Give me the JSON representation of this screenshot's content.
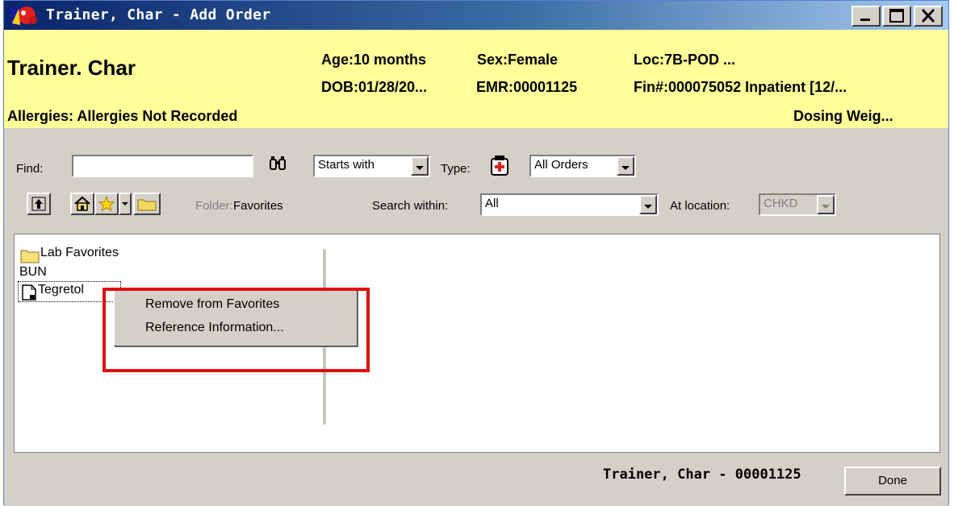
{
  "window": {
    "title": "Trainer, Char - Add Order",
    "controls": {
      "minimize": "minimize",
      "maximize": "maximize",
      "close": "close"
    }
  },
  "banner": {
    "patient_name": "Trainer. Char",
    "age": "Age:10 months",
    "sex": "Sex:Female",
    "loc": "Loc:7B-POD ...",
    "dob": "DOB:01/28/20...",
    "emr": "EMR:00001125",
    "fin": "Fin#:000075052 Inpatient [12/...",
    "allergies": "Allergies: Allergies Not Recorded",
    "dosing_weight": "Dosing Weig...",
    "background_color": "#ffff99"
  },
  "search": {
    "find_label": "Find:",
    "find_value": "",
    "match_mode": "Starts with",
    "type_label": "Type:",
    "type_value": "All Orders",
    "folder_label": "Folder:",
    "folder_value": "Favorites",
    "search_within_label": "Search within:",
    "search_within_value": "All",
    "at_location_label": "At location:",
    "at_location_value": "CHKD"
  },
  "icons": {
    "binoculars": "binoculars-icon",
    "order_type": "order-type-icon",
    "up": "up-folder-icon",
    "home": "home-icon",
    "star": "favorites-star-icon",
    "folder": "folder-icon",
    "document": "document-icon"
  },
  "list": {
    "items": [
      "Lab Favorites",
      "BUN",
      "Tegretol"
    ]
  },
  "context_menu": {
    "items": [
      "Remove from Favorites",
      "Reference Information..."
    ],
    "highlight_color": "#e01010"
  },
  "footer": {
    "patient_id": "Trainer, Char - 00001125",
    "done_label": "Done"
  }
}
